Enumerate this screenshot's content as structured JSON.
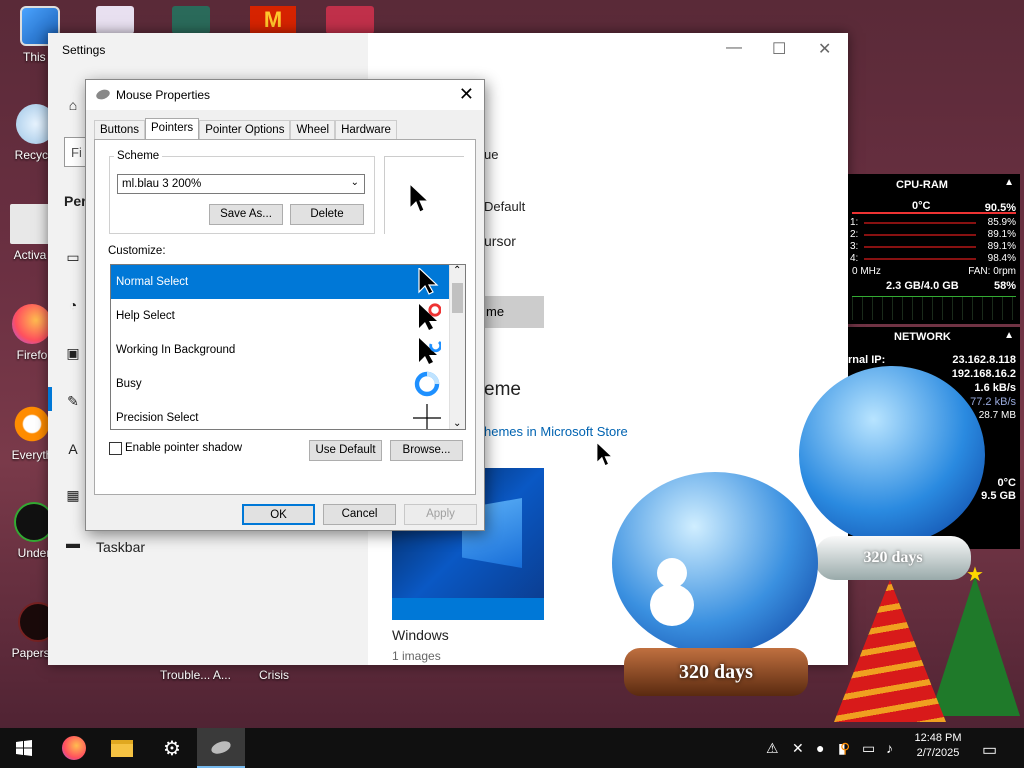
{
  "desktop": {
    "icons": [
      {
        "label": "This P",
        "icon": "this-pc-icon"
      },
      {
        "label": "Recycle",
        "icon": "recycle-bin-icon"
      },
      {
        "label": "Activa",
        "icon": "activation-icon"
      },
      {
        "label": "Firefo",
        "icon": "firefox-icon"
      },
      {
        "label": "Everyth",
        "icon": "everything-icon"
      },
      {
        "label": "Under",
        "icon": "undertale-icon"
      },
      {
        "label": "Papers, P",
        "icon": "papers-please-icon"
      }
    ],
    "bottom_labels": [
      "Trouble... A...",
      "Crisis"
    ]
  },
  "settings": {
    "title": "Settings",
    "search_placeholder": "Fi",
    "section_heading": "Per",
    "nav_last_label": "Taskbar",
    "fragment_ue": "ue",
    "fragment_default": "Default",
    "fragment_cursor": "ursor",
    "fragment_button": "me",
    "fragment_heading": "eme",
    "store_link": "hemes in Microsoft Store",
    "theme_name": "Windows",
    "theme_count": "1 images"
  },
  "mouse": {
    "title": "Mouse Properties",
    "tabs": [
      "Buttons",
      "Pointers",
      "Pointer Options",
      "Wheel",
      "Hardware"
    ],
    "active_tab": "Pointers",
    "scheme_label": "Scheme",
    "scheme_value": "ml.blau 3 200%",
    "save_as": "Save As...",
    "delete": "Delete",
    "customize_label": "Customize:",
    "list": [
      {
        "label": "Normal Select",
        "cursor": "arrow"
      },
      {
        "label": "Help Select",
        "cursor": "help"
      },
      {
        "label": "Working In Background",
        "cursor": "working"
      },
      {
        "label": "Busy",
        "cursor": "busy"
      },
      {
        "label": "Precision Select",
        "cursor": "cross"
      }
    ],
    "shadow_label": "Enable pointer shadow",
    "use_default": "Use Default",
    "browse": "Browse...",
    "ok": "OK",
    "cancel": "Cancel",
    "apply": "Apply"
  },
  "cpu_widget": {
    "title": "CPU-RAM",
    "temp": "0°C",
    "usage": "90.5%",
    "cores": [
      {
        "id": "1:",
        "val": "85.9%"
      },
      {
        "id": "2:",
        "val": "89.1%"
      },
      {
        "id": "3:",
        "val": "89.1%"
      },
      {
        "id": "4:",
        "val": "98.4%"
      }
    ],
    "freq": "0 MHz",
    "fan": "FAN: 0rpm",
    "ram": "2.3 GB/4.0 GB",
    "ram_pct": "58%"
  },
  "network_widget": {
    "title": "NETWORK",
    "internal_label": "rnal IP:",
    "internal_ip": "23.162.8.118",
    "local_ip": "192.168.16.2",
    "rate1": "1.6 kB/s",
    "rate2": "77.2 kB/s",
    "rate3": "28.7 MB",
    "temp2": "0°C",
    "disk": "9.5 GB"
  },
  "snow_globes": [
    {
      "label": "320 days"
    },
    {
      "label": "320 days"
    }
  ],
  "taskbar": {
    "time": "12:48 PM",
    "date": "2/7/2025"
  }
}
